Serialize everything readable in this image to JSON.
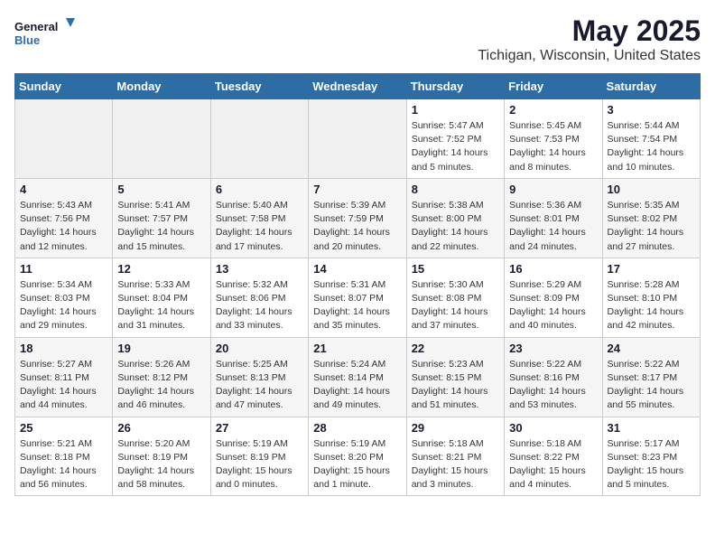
{
  "header": {
    "logo_line1": "General",
    "logo_line2": "Blue",
    "main_title": "May 2025",
    "sub_title": "Tichigan, Wisconsin, United States"
  },
  "weekdays": [
    "Sunday",
    "Monday",
    "Tuesday",
    "Wednesday",
    "Thursday",
    "Friday",
    "Saturday"
  ],
  "weeks": [
    [
      {
        "day": "",
        "info": ""
      },
      {
        "day": "",
        "info": ""
      },
      {
        "day": "",
        "info": ""
      },
      {
        "day": "",
        "info": ""
      },
      {
        "day": "1",
        "info": "Sunrise: 5:47 AM\nSunset: 7:52 PM\nDaylight: 14 hours\nand 5 minutes."
      },
      {
        "day": "2",
        "info": "Sunrise: 5:45 AM\nSunset: 7:53 PM\nDaylight: 14 hours\nand 8 minutes."
      },
      {
        "day": "3",
        "info": "Sunrise: 5:44 AM\nSunset: 7:54 PM\nDaylight: 14 hours\nand 10 minutes."
      }
    ],
    [
      {
        "day": "4",
        "info": "Sunrise: 5:43 AM\nSunset: 7:56 PM\nDaylight: 14 hours\nand 12 minutes."
      },
      {
        "day": "5",
        "info": "Sunrise: 5:41 AM\nSunset: 7:57 PM\nDaylight: 14 hours\nand 15 minutes."
      },
      {
        "day": "6",
        "info": "Sunrise: 5:40 AM\nSunset: 7:58 PM\nDaylight: 14 hours\nand 17 minutes."
      },
      {
        "day": "7",
        "info": "Sunrise: 5:39 AM\nSunset: 7:59 PM\nDaylight: 14 hours\nand 20 minutes."
      },
      {
        "day": "8",
        "info": "Sunrise: 5:38 AM\nSunset: 8:00 PM\nDaylight: 14 hours\nand 22 minutes."
      },
      {
        "day": "9",
        "info": "Sunrise: 5:36 AM\nSunset: 8:01 PM\nDaylight: 14 hours\nand 24 minutes."
      },
      {
        "day": "10",
        "info": "Sunrise: 5:35 AM\nSunset: 8:02 PM\nDaylight: 14 hours\nand 27 minutes."
      }
    ],
    [
      {
        "day": "11",
        "info": "Sunrise: 5:34 AM\nSunset: 8:03 PM\nDaylight: 14 hours\nand 29 minutes."
      },
      {
        "day": "12",
        "info": "Sunrise: 5:33 AM\nSunset: 8:04 PM\nDaylight: 14 hours\nand 31 minutes."
      },
      {
        "day": "13",
        "info": "Sunrise: 5:32 AM\nSunset: 8:06 PM\nDaylight: 14 hours\nand 33 minutes."
      },
      {
        "day": "14",
        "info": "Sunrise: 5:31 AM\nSunset: 8:07 PM\nDaylight: 14 hours\nand 35 minutes."
      },
      {
        "day": "15",
        "info": "Sunrise: 5:30 AM\nSunset: 8:08 PM\nDaylight: 14 hours\nand 37 minutes."
      },
      {
        "day": "16",
        "info": "Sunrise: 5:29 AM\nSunset: 8:09 PM\nDaylight: 14 hours\nand 40 minutes."
      },
      {
        "day": "17",
        "info": "Sunrise: 5:28 AM\nSunset: 8:10 PM\nDaylight: 14 hours\nand 42 minutes."
      }
    ],
    [
      {
        "day": "18",
        "info": "Sunrise: 5:27 AM\nSunset: 8:11 PM\nDaylight: 14 hours\nand 44 minutes."
      },
      {
        "day": "19",
        "info": "Sunrise: 5:26 AM\nSunset: 8:12 PM\nDaylight: 14 hours\nand 46 minutes."
      },
      {
        "day": "20",
        "info": "Sunrise: 5:25 AM\nSunset: 8:13 PM\nDaylight: 14 hours\nand 47 minutes."
      },
      {
        "day": "21",
        "info": "Sunrise: 5:24 AM\nSunset: 8:14 PM\nDaylight: 14 hours\nand 49 minutes."
      },
      {
        "day": "22",
        "info": "Sunrise: 5:23 AM\nSunset: 8:15 PM\nDaylight: 14 hours\nand 51 minutes."
      },
      {
        "day": "23",
        "info": "Sunrise: 5:22 AM\nSunset: 8:16 PM\nDaylight: 14 hours\nand 53 minutes."
      },
      {
        "day": "24",
        "info": "Sunrise: 5:22 AM\nSunset: 8:17 PM\nDaylight: 14 hours\nand 55 minutes."
      }
    ],
    [
      {
        "day": "25",
        "info": "Sunrise: 5:21 AM\nSunset: 8:18 PM\nDaylight: 14 hours\nand 56 minutes."
      },
      {
        "day": "26",
        "info": "Sunrise: 5:20 AM\nSunset: 8:19 PM\nDaylight: 14 hours\nand 58 minutes."
      },
      {
        "day": "27",
        "info": "Sunrise: 5:19 AM\nSunset: 8:19 PM\nDaylight: 15 hours\nand 0 minutes."
      },
      {
        "day": "28",
        "info": "Sunrise: 5:19 AM\nSunset: 8:20 PM\nDaylight: 15 hours\nand 1 minute."
      },
      {
        "day": "29",
        "info": "Sunrise: 5:18 AM\nSunset: 8:21 PM\nDaylight: 15 hours\nand 3 minutes."
      },
      {
        "day": "30",
        "info": "Sunrise: 5:18 AM\nSunset: 8:22 PM\nDaylight: 15 hours\nand 4 minutes."
      },
      {
        "day": "31",
        "info": "Sunrise: 5:17 AM\nSunset: 8:23 PM\nDaylight: 15 hours\nand 5 minutes."
      }
    ]
  ]
}
